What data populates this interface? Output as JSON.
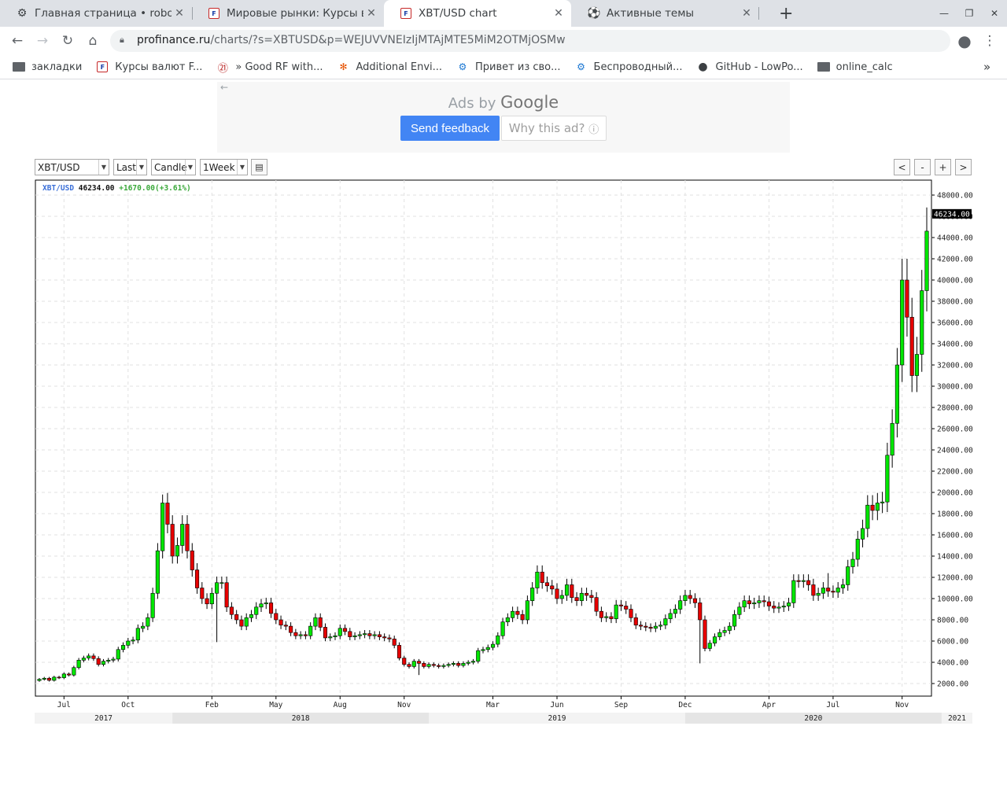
{
  "browser": {
    "tabs": [
      {
        "title": "Главная страница • robof",
        "icon": "gear-icon",
        "active": false
      },
      {
        "title": "Мировые рынки: Курсы ва",
        "icon": "profinance-icon",
        "active": false
      },
      {
        "title": "XBT/USD chart",
        "icon": "profinance-icon",
        "active": true
      },
      {
        "title": "Активные темы",
        "icon": "football-icon",
        "active": false
      }
    ],
    "tab_close": "✕",
    "new_tab": "+",
    "url_domain": "profinance.ru",
    "url_path": "/charts/?s=XBTUSD&p=WEJUVVNEIzIjMTAjMTE5MiM2OTMjOSMw",
    "bookmarks": [
      {
        "label": "закладки",
        "icon": "folder-icon"
      },
      {
        "label": "Курсы валют F...",
        "icon": "profinance-icon"
      },
      {
        "label": "» Good RF with...",
        "icon": "rf-icon"
      },
      {
        "label": "Additional Envi...",
        "icon": "joomla-icon"
      },
      {
        "label": "Привет из сво...",
        "icon": "gear-icon"
      },
      {
        "label": "Беспроводный...",
        "icon": "gear-icon"
      },
      {
        "label": "GitHub - LowPo...",
        "icon": "github-icon"
      },
      {
        "label": "online_calc",
        "icon": "folder-icon"
      }
    ],
    "bookmarks_more": "»"
  },
  "ad": {
    "ads_by": "Ads by",
    "google": "Google",
    "send_feedback": "Send feedback",
    "why": "Why this ad?",
    "back": "←",
    "info": "ⓘ"
  },
  "controls": {
    "symbol": "XBT/USD",
    "price_type": "Last",
    "chart_type": "Candle",
    "period": "1Week",
    "nav_prev": "<",
    "zoom_out": "-",
    "zoom_in": "+",
    "nav_next": ">"
  },
  "colors": {
    "up": "#00e600",
    "down": "#e60000",
    "info_symbol": "#3a6fd8",
    "info_change": "#3aa83a"
  },
  "chart_data": {
    "type": "candlestick",
    "symbol": "XBT/USD",
    "last": "46234.00",
    "change": "+1670.00(+3.61%)",
    "ylim": [
      1000,
      49000
    ],
    "yticks": [
      2000,
      4000,
      6000,
      8000,
      10000,
      12000,
      14000,
      16000,
      18000,
      20000,
      22000,
      24000,
      26000,
      28000,
      30000,
      32000,
      34000,
      36000,
      38000,
      40000,
      42000,
      44000,
      46000,
      48000
    ],
    "ytick_labels": [
      "2000.00",
      "4000.00",
      "6000.00",
      "8000.00",
      "10000.00",
      "12000.00",
      "14000.00",
      "16000.00",
      "18000.00",
      "20000.00",
      "22000.00",
      "24000.00",
      "26000.00",
      "28000.00",
      "30000.00",
      "32000.00",
      "34000.00",
      "36000.00",
      "38000.00",
      "40000.00",
      "42000.00",
      "44000.00",
      "46000.00",
      "48000.00"
    ],
    "x_start": "2017-05-29",
    "interval": "1 week",
    "month_labels": [
      {
        "label": "Jul",
        "week": 5
      },
      {
        "label": "Oct",
        "week": 18
      },
      {
        "label": "Feb",
        "week": 35
      },
      {
        "label": "May",
        "week": 48
      },
      {
        "label": "Aug",
        "week": 61
      },
      {
        "label": "Nov",
        "week": 74
      },
      {
        "label": "Mar",
        "week": 92
      },
      {
        "label": "Jun",
        "week": 105
      },
      {
        "label": "Sep",
        "week": 118
      },
      {
        "label": "Dec",
        "week": 131
      },
      {
        "label": "Apr",
        "week": 148
      },
      {
        "label": "Jul",
        "week": 161
      },
      {
        "label": "Nov",
        "week": 175
      }
    ],
    "year_labels": [
      {
        "label": "2017",
        "from": 0,
        "to": 27
      },
      {
        "label": "2018",
        "from": 27,
        "to": 79
      },
      {
        "label": "2019",
        "from": 79,
        "to": 131
      },
      {
        "label": "2020",
        "from": 131,
        "to": 183
      },
      {
        "label": "2021",
        "from": 183,
        "to": 199
      }
    ],
    "close": [
      2400,
      2500,
      2300,
      2600,
      2550,
      2900,
      2800,
      3500,
      4200,
      4400,
      4600,
      4350,
      3800,
      4100,
      4200,
      4300,
      5200,
      5600,
      6000,
      6100,
      7200,
      7400,
      8200,
      10500,
      14500,
      19000,
      17000,
      14000,
      15000,
      17000,
      14500,
      12700,
      11000,
      10000,
      9500,
      10500,
      11500,
      11500,
      9200,
      8500,
      8000,
      7400,
      8200,
      8500,
      9200,
      9500,
      9600,
      8600,
      8000,
      7500,
      7400,
      6800,
      6500,
      6600,
      6500,
      7400,
      8200,
      7300,
      6300,
      6400,
      6500,
      7200,
      6900,
      6400,
      6500,
      6600,
      6700,
      6500,
      6600,
      6400,
      6300,
      6200,
      5600,
      4400,
      3800,
      3600,
      4100,
      3900,
      3600,
      3800,
      3700,
      3600,
      3700,
      3800,
      3900,
      3700,
      3900,
      4000,
      4100,
      5100,
      5200,
      5400,
      5700,
      6500,
      7800,
      8200,
      8800,
      8500,
      8000,
      9800,
      11000,
      12500,
      11500,
      11200,
      10900,
      10000,
      10300,
      11300,
      10100,
      9800,
      10500,
      10300,
      10100,
      8800,
      8200,
      8300,
      8100,
      9400,
      9300,
      9000,
      8200,
      7500,
      7400,
      7300,
      7200,
      7400,
      7500,
      8100,
      8600,
      9000,
      9800,
      10300,
      10000,
      9600,
      8000,
      5300,
      5800,
      6400,
      6800,
      7000,
      7400,
      8500,
      9200,
      9800,
      9500,
      9600,
      9800,
      9700,
      9300,
      9100,
      9200,
      9300,
      9600,
      11700,
      11600,
      11700,
      11300,
      10300,
      10500,
      11000,
      10700,
      10600,
      11000,
      11300,
      13000,
      13700,
      15600,
      16600,
      18800,
      18300,
      19000,
      19100,
      23500,
      26500,
      32000,
      40000,
      36500,
      31000,
      33000,
      39000,
      44600
    ],
    "highs": {
      "25": 19800,
      "160": 12400,
      "183": 41900,
      "184": 40300,
      "187": 40000,
      "188": 48200
    },
    "lows": {
      "36": 5900,
      "77": 2800,
      "134": 3900,
      "185": 29000,
      "186": 28000
    }
  }
}
